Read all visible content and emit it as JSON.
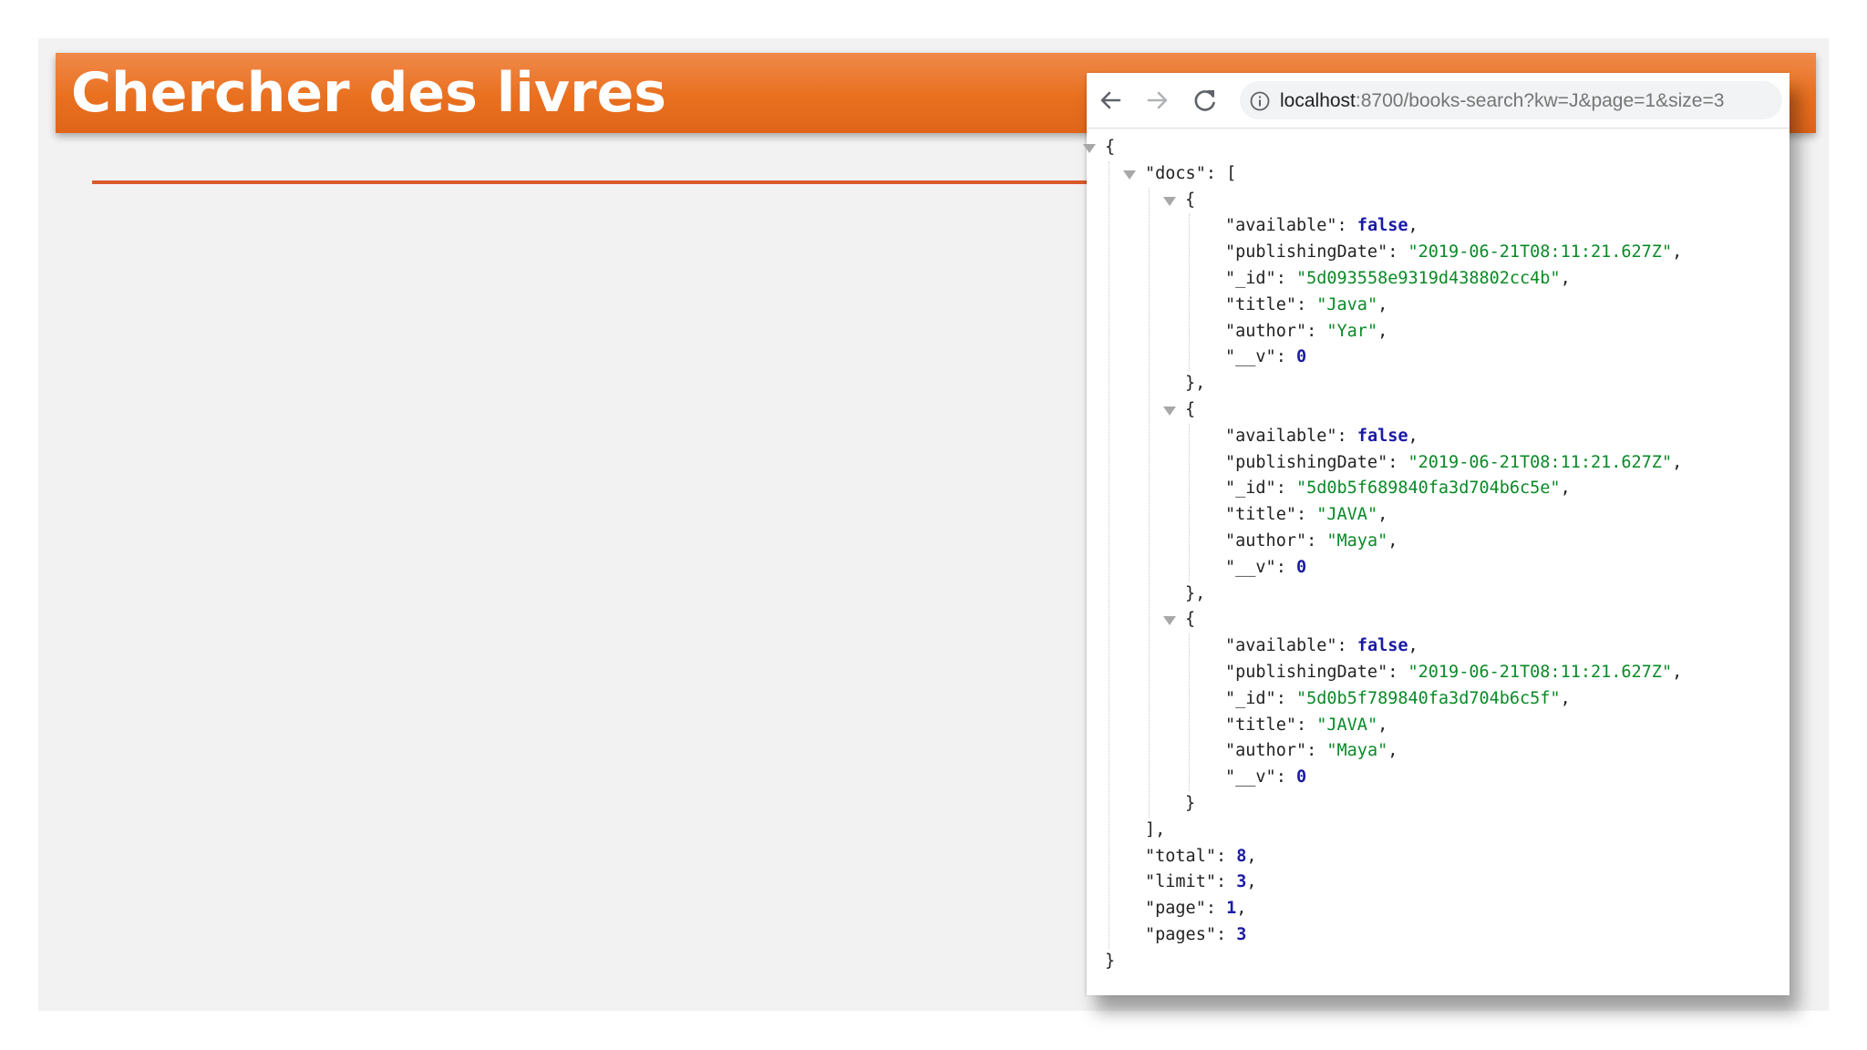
{
  "slide": {
    "title": "Chercher des livres"
  },
  "browser": {
    "url_host": "localhost",
    "url_rest": ":8700/books-search?kw=J&page=1&size=3",
    "icons": [
      "back-arrow-icon",
      "forward-arrow-icon",
      "reload-icon",
      "info-icon"
    ]
  },
  "response": {
    "docs": [
      {
        "available": "false",
        "publishingDate": "\"2019-06-21T08:11:21.627Z\"",
        "_id": "\"5d093558e9319d438802cc4b\"",
        "title": "\"Java\"",
        "author": "\"Yar\"",
        "__v": "0"
      },
      {
        "available": "false",
        "publishingDate": "\"2019-06-21T08:11:21.627Z\"",
        "_id": "\"5d0b5f689840fa3d704b6c5e\"",
        "title": "\"JAVA\"",
        "author": "\"Maya\"",
        "__v": "0"
      },
      {
        "available": "false",
        "publishingDate": "\"2019-06-21T08:11:21.627Z\"",
        "_id": "\"5d0b5f789840fa3d704b6c5f\"",
        "title": "\"JAVA\"",
        "author": "\"Maya\"",
        "__v": "0"
      }
    ],
    "total": "8",
    "limit": "3",
    "page": "1",
    "pages": "3"
  },
  "json_keys": {
    "docs": "\"docs\"",
    "available": "\"available\"",
    "publishingDate": "\"publishingDate\"",
    "_id": "\"_id\"",
    "title": "\"title\"",
    "author": "\"author\"",
    "__v": "\"__v\"",
    "total": "\"total\"",
    "limit": "\"limit\"",
    "page": "\"page\"",
    "pages": "\"pages\""
  }
}
